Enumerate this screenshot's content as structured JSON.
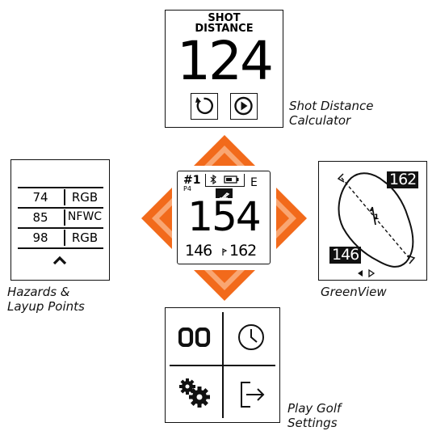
{
  "captions": {
    "top": [
      "Shot Distance",
      "Calculator"
    ],
    "left": [
      "Hazards &",
      "Layup Points"
    ],
    "right": [
      "GreenView"
    ],
    "bottom": [
      "Play Golf",
      "Settings"
    ]
  },
  "shot_distance_screen": {
    "title_line1": "SHOT",
    "title_line2": "DISTANCE",
    "distance": "124"
  },
  "main_screen": {
    "hole": "#1",
    "par": "P4",
    "score": "E",
    "middle_distance": "154",
    "front_distance": "146",
    "back_distance": "162"
  },
  "hazards_screen": {
    "rows": [
      {
        "yards": "74",
        "name": "RGB"
      },
      {
        "yards": "85",
        "name": "NFWC"
      },
      {
        "yards": "98",
        "name": "RGB"
      }
    ]
  },
  "greenview_screen": {
    "back_distance": "162",
    "front_distance": "146",
    "pin_number": "1"
  },
  "colors": {
    "arrow_orange": "#f26a1b",
    "arrow_light": "#f9a672",
    "ink": "#111111"
  }
}
